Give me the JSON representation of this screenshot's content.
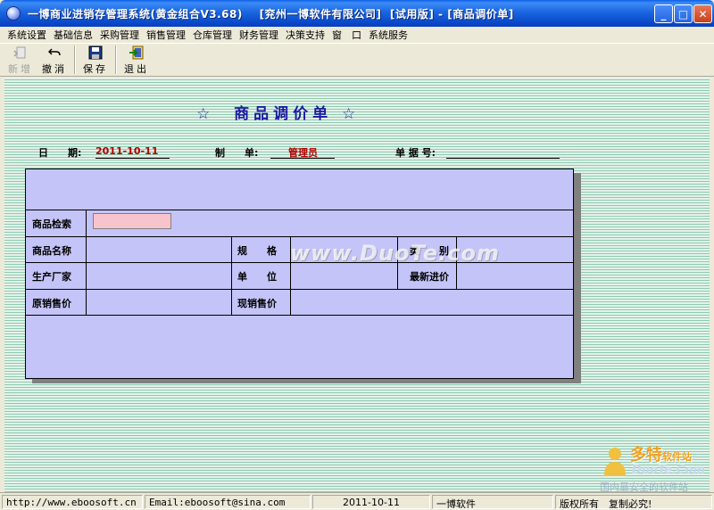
{
  "window": {
    "title": "一博商业进销存管理系统(黄金组合V3.68)    [兖州一博软件有限公司]  [试用版] - [商品调价单]",
    "min_label": "_",
    "max_label": "□",
    "close_label": "✕"
  },
  "menu": {
    "items": [
      "系统设置",
      "基础信息",
      "采购管理",
      "销售管理",
      "仓库管理",
      "财务管理",
      "决策支持",
      "窗　口",
      "系统服务"
    ]
  },
  "toolbar": {
    "new_label": "新增",
    "undo_label": "撤消",
    "save_label": "保存",
    "exit_label": "退出"
  },
  "form": {
    "title": "☆  商品调价单 ☆",
    "date_label": "日　　期:",
    "date_value": "2011-10-11",
    "maker_label": "制　　单:",
    "maker_value": "管理员",
    "docno_label": "单 据 号:",
    "docno_value": "",
    "fields": {
      "search_label": "商品检索",
      "name_label": "商品名称",
      "spec_label": "规　　格",
      "category_label": "类　　别",
      "maker_label": "生产厂家",
      "unit_label": "单　　位",
      "latest_price_label": "最新进价",
      "old_price_label": "原销售价",
      "new_price_label": "现销售价"
    }
  },
  "watermark": {
    "text": "www.DuoTe.com"
  },
  "status": {
    "url": "http://www.eboosoft.cn",
    "email": "Email:eboosoft@sina.com",
    "date": "2011-10-11",
    "company": "一博软件",
    "copyright": "版权所有　复制必究!"
  },
  "site_logo": {
    "line1": "多特",
    "line1_small": "软件站",
    "line2": "DuoTe.Com",
    "line3": "国内最安全的软件站"
  }
}
